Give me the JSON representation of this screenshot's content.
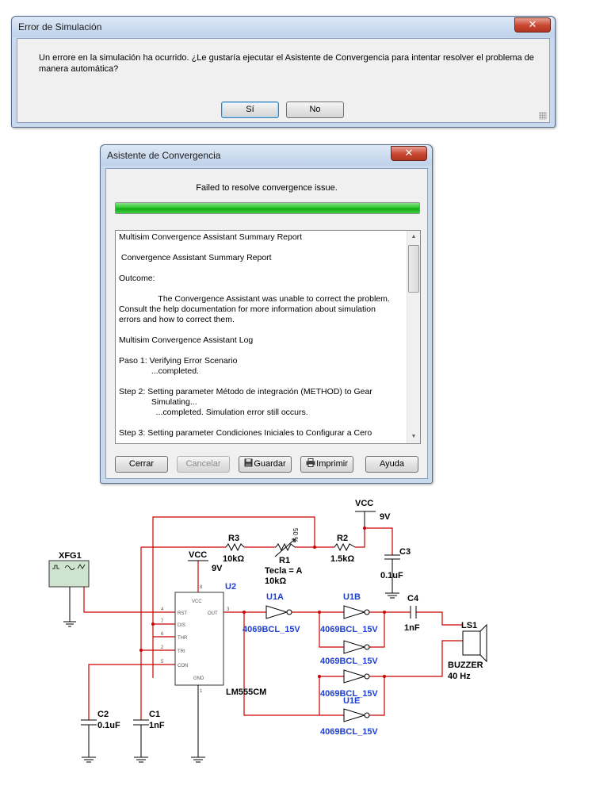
{
  "error_dialog": {
    "title": "Error de Simulación",
    "close_glyph": "✕",
    "message": "Un errore en la simulación ha ocurrido. ¿Le gustaría ejecutar el Asistente de Convergencia para intentar resolver el problema de manera automática?",
    "yes_label": "Sí",
    "no_label": "No"
  },
  "convergence_dialog": {
    "title": "Asistente de Convergencia",
    "close_glyph": "✕",
    "status": "Failed to resolve convergence issue.",
    "progress": 1.0,
    "report_lines": [
      "Multisim Convergence Assistant Summary Report",
      "",
      " Convergence Assistant Summary Report",
      "",
      "Outcome:",
      "",
      "                 The Convergence Assistant was unable to correct the problem.",
      "Consult the help documentation for more information about simulation",
      "errors and how to correct them.",
      "",
      "Multisim Convergence Assistant Log",
      "",
      "Paso 1: Verifying Error Scenario",
      "              ...completed.",
      "",
      "Step 2: Setting parameter Método de integración (METHOD) to Gear",
      "              Simulating...",
      "                ...completed. Simulation error still occurs.",
      "",
      "Step 3: Setting parameter Condiciones Iniciales to Configurar a Cero"
    ],
    "buttons": {
      "close": "Cerrar",
      "cancel": "Cancelar",
      "save": "Guardar",
      "print": "Imprimir",
      "help": "Ayuda"
    }
  },
  "schematic": {
    "vcc_top": "VCC",
    "vcc_top_val": "9V",
    "vcc_left": "VCC",
    "vcc_left_val": "9V",
    "r3_name": "R3",
    "r3_val": "10kΩ",
    "r1_name": "R1",
    "r1_key": "Tecla = A",
    "r1_val": "10kΩ",
    "r1_pct": "50 %",
    "r2_name": "R2",
    "r2_val": "1.5kΩ",
    "c3_name": "C3",
    "c3_val": "0.1uF",
    "xfg_name": "XFG1",
    "u2_name": "U2",
    "u2_part": "LM555CM",
    "u2_pins": {
      "vcc": "VCC",
      "rst": "RST",
      "out": "OUT",
      "dis": "DIS",
      "thr": "THR",
      "tri": "TRI",
      "con": "CON",
      "gnd": "GND"
    },
    "u2_pin_numbers": {
      "p8": "8",
      "p4": "4",
      "p3": "3",
      "p7": "7",
      "p6": "6",
      "p2": "2",
      "p5": "5",
      "p1": "1"
    },
    "u1a_name": "U1A",
    "u1a_part": "4069BCL_15V",
    "u1b_name": "U1B",
    "u1b_part": "4069BCL_15V",
    "u1c_part": "4069BCL_15V",
    "u1d_part": "4069BCL_15V",
    "u1e_name": "U1E",
    "u1e_part": "4069BCL_15V",
    "u1f_part": "4069BCL_15V",
    "c4_name": "C4",
    "c4_val": "1nF",
    "ls1_name": "LS1",
    "ls1_type": "BUZZER",
    "ls1_freq": "40 Hz",
    "c2_name": "C2",
    "c2_val": "0.1uF",
    "c1_name": "C1",
    "c1_val": "1nF",
    "wire_color": "#cc0000",
    "part_color": "#1f3fd0"
  }
}
